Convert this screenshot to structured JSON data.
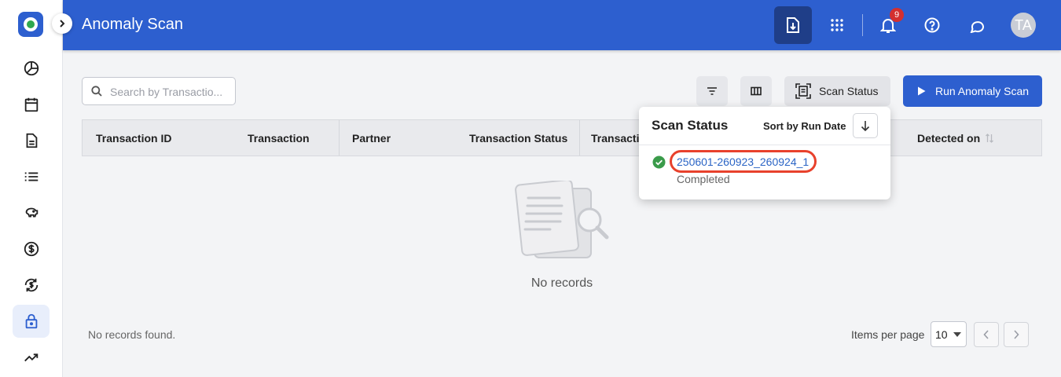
{
  "header": {
    "title": "Anomaly Scan",
    "notification_count": "9",
    "avatar_initials": "TA"
  },
  "sidebar": {
    "items": [
      {
        "name": "pie-chart-icon"
      },
      {
        "name": "calendar-icon"
      },
      {
        "name": "document-icon"
      },
      {
        "name": "list-icon"
      },
      {
        "name": "piggy-bank-icon"
      },
      {
        "name": "dollar-circle-icon"
      },
      {
        "name": "dollar-refresh-icon"
      },
      {
        "name": "lock-icon",
        "active": true
      },
      {
        "name": "trending-up-icon"
      }
    ]
  },
  "toolbar": {
    "search_placeholder": "Search by Transactio...",
    "scan_status_label": "Scan Status",
    "run_label": "Run Anomaly Scan"
  },
  "table": {
    "columns": [
      "Transaction ID",
      "Transaction T...",
      "Partner",
      "Transaction Status",
      "Transactio",
      "Detected on"
    ],
    "empty_text": "No records",
    "footer_text": "No records found.",
    "items_per_page_label": "Items per page",
    "items_per_page_value": "10"
  },
  "scan_popover": {
    "title": "Scan Status",
    "sort_label": "Sort by Run Date",
    "scans": [
      {
        "id": "250601-260923_260924_1",
        "status": "Completed"
      }
    ]
  },
  "colors": {
    "brand": "#2d5fcf",
    "success": "#3a9b4a",
    "highlight_ring": "#e8412c",
    "link": "#2a64c5"
  }
}
